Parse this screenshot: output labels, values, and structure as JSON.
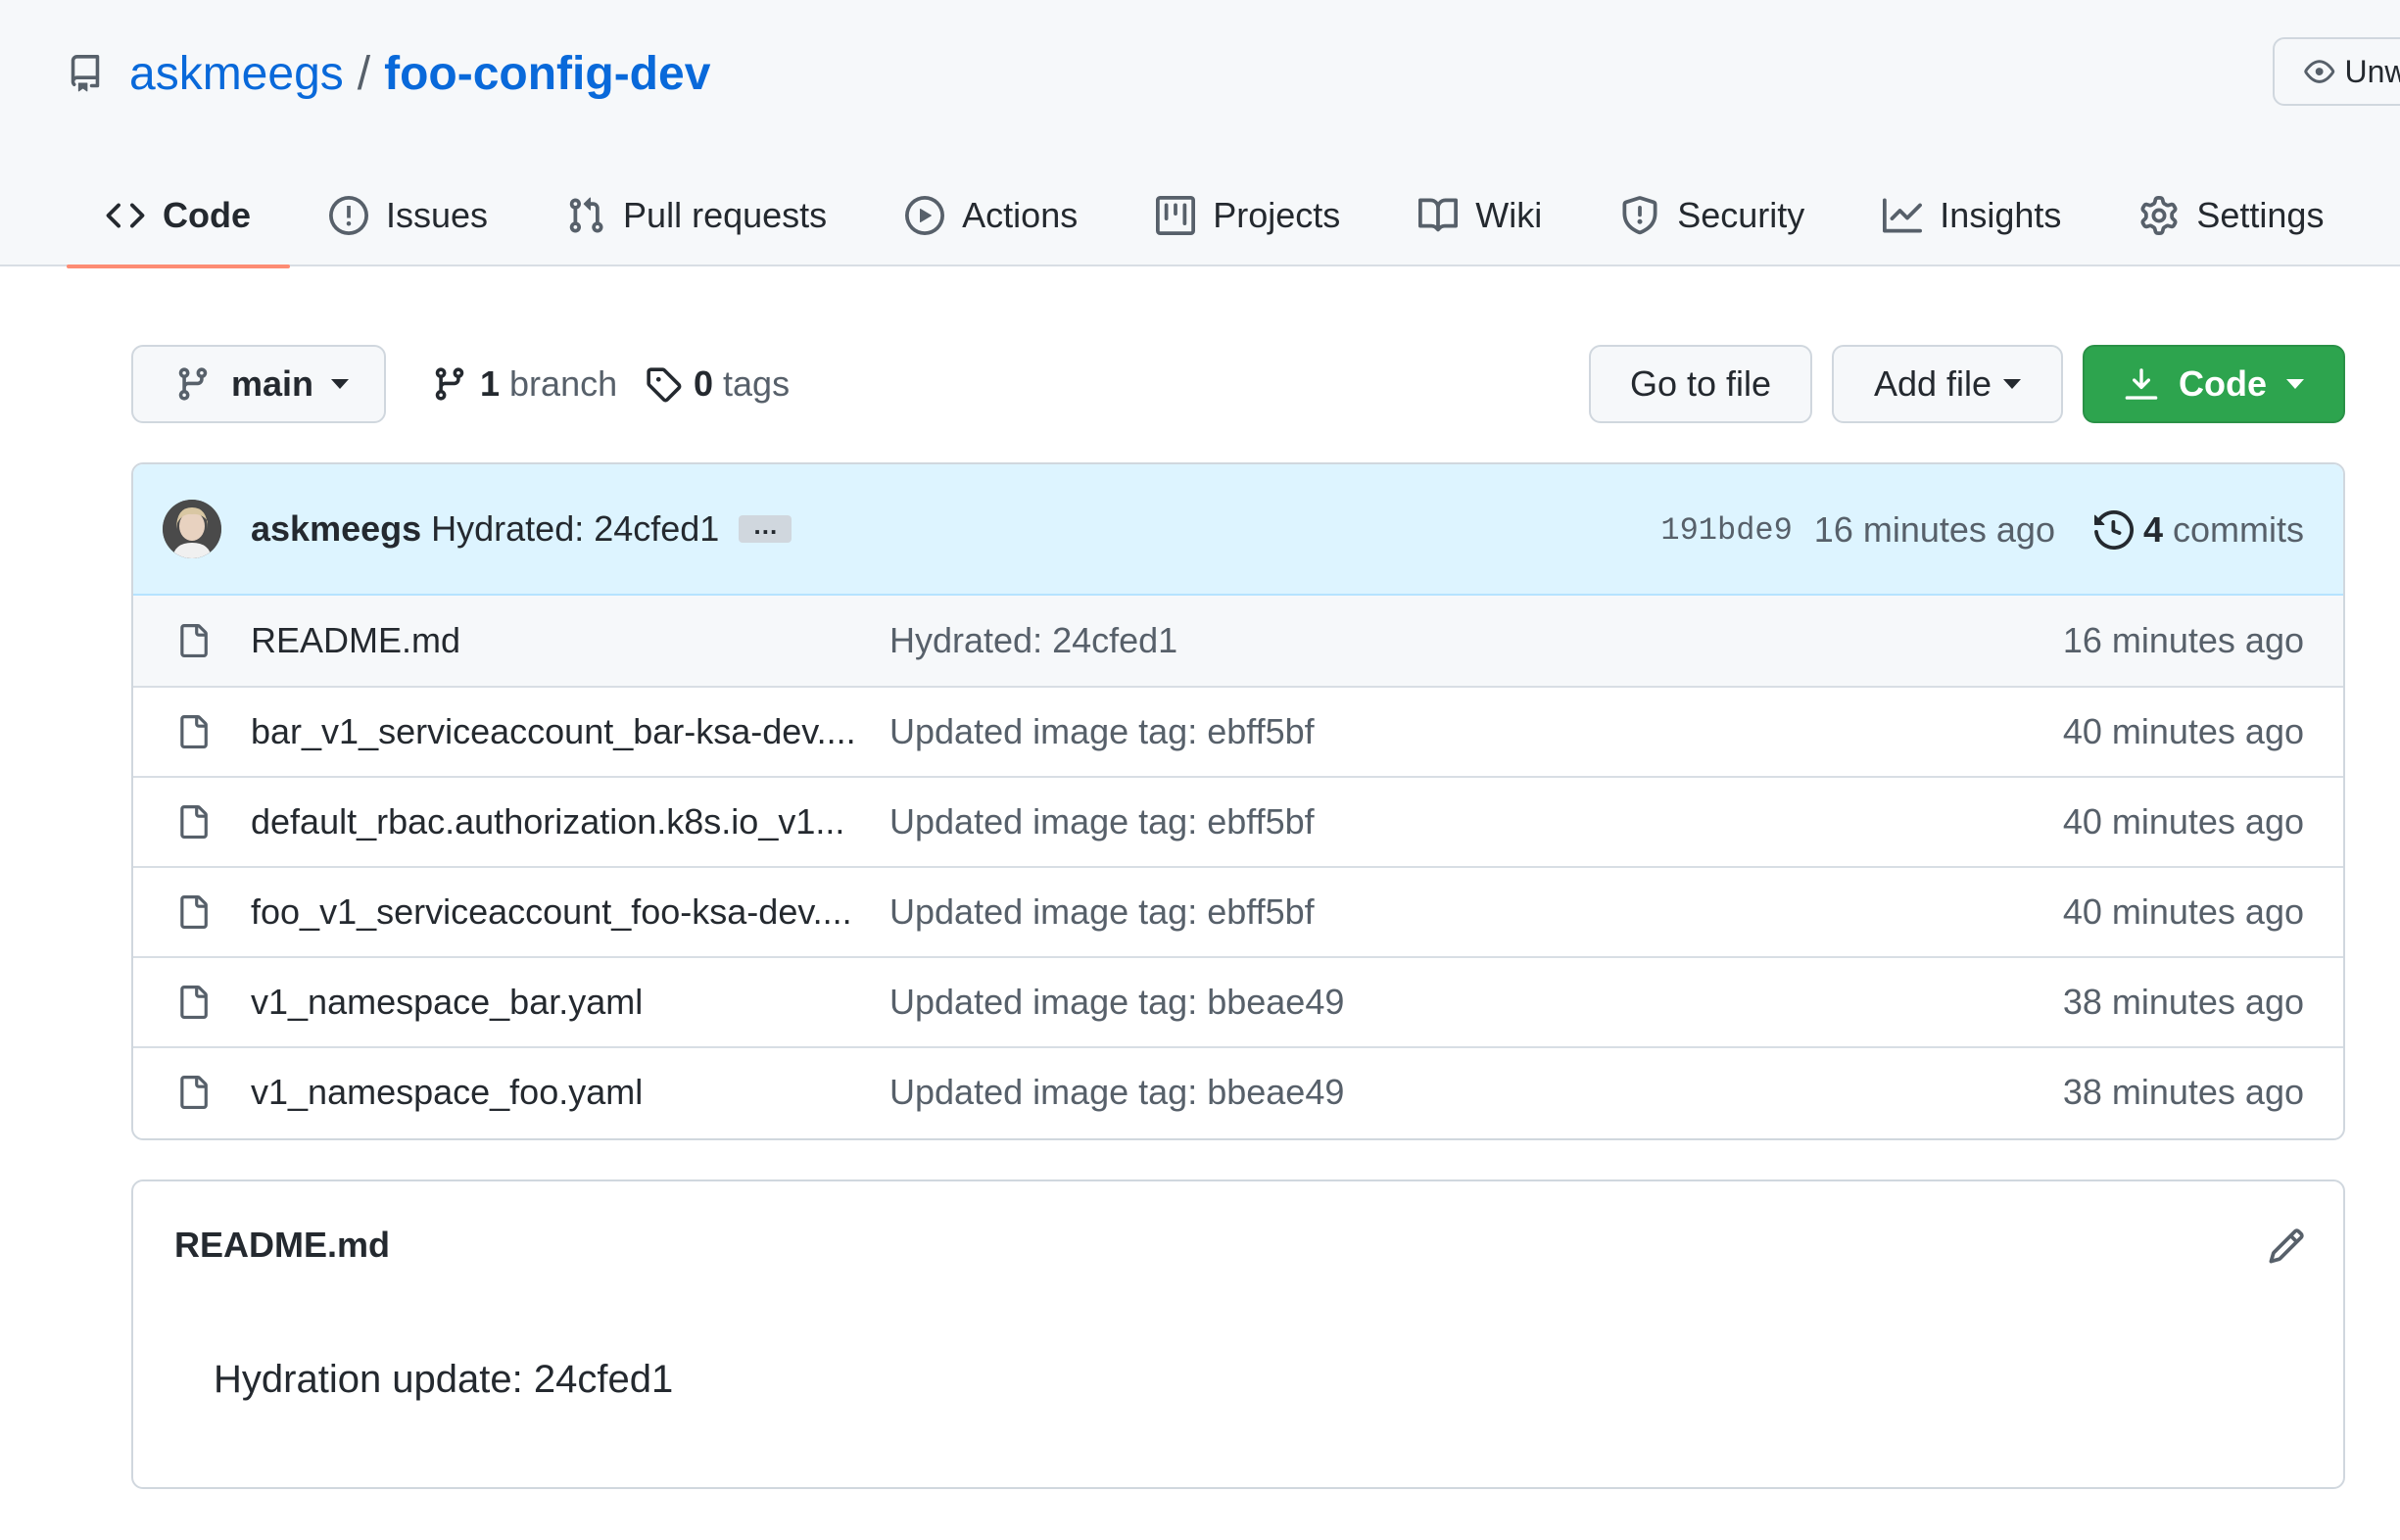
{
  "repo": {
    "owner": "askmeegs",
    "separator": "/",
    "name": "foo-config-dev",
    "watch_label": "Unwatch"
  },
  "tabs": [
    {
      "label": "Code",
      "icon": "code-icon",
      "active": true
    },
    {
      "label": "Issues",
      "icon": "issue-icon"
    },
    {
      "label": "Pull requests",
      "icon": "pull-request-icon"
    },
    {
      "label": "Actions",
      "icon": "play-icon"
    },
    {
      "label": "Projects",
      "icon": "project-icon"
    },
    {
      "label": "Wiki",
      "icon": "book-icon"
    },
    {
      "label": "Security",
      "icon": "shield-icon"
    },
    {
      "label": "Insights",
      "icon": "graph-icon"
    },
    {
      "label": "Settings",
      "icon": "gear-icon"
    }
  ],
  "toolbar": {
    "branch": "main",
    "branch_count": "1",
    "branch_label": "branch",
    "tag_count": "0",
    "tag_label": "tags",
    "goto_file": "Go to file",
    "add_file": "Add file",
    "code": "Code"
  },
  "latest_commit": {
    "author": "askmeegs",
    "message": "Hydrated: 24cfed1",
    "ellipsis": "…",
    "sha": "191bde9",
    "time": "16 minutes ago",
    "commit_count": "4",
    "commit_label": "commits"
  },
  "files": [
    {
      "name": "README.md",
      "message": "Hydrated: 24cfed1",
      "time": "16 minutes ago"
    },
    {
      "name": "bar_v1_serviceaccount_bar-ksa-dev....",
      "message": "Updated image tag: ebff5bf",
      "time": "40 minutes ago"
    },
    {
      "name": "default_rbac.authorization.k8s.io_v1...",
      "message": "Updated image tag: ebff5bf",
      "time": "40 minutes ago"
    },
    {
      "name": "foo_v1_serviceaccount_foo-ksa-dev....",
      "message": "Updated image tag: ebff5bf",
      "time": "40 minutes ago"
    },
    {
      "name": "v1_namespace_bar.yaml",
      "message": "Updated image tag: bbeae49",
      "time": "38 minutes ago"
    },
    {
      "name": "v1_namespace_foo.yaml",
      "message": "Updated image tag: bbeae49",
      "time": "38 minutes ago"
    }
  ],
  "readme": {
    "title": "README.md",
    "content": "Hydration update: 24cfed1"
  },
  "colors": {
    "link": "#0969da",
    "active_tab_underline": "#fd8c73",
    "primary_button": "#2da44e",
    "commit_bar": "#ddf4ff"
  }
}
